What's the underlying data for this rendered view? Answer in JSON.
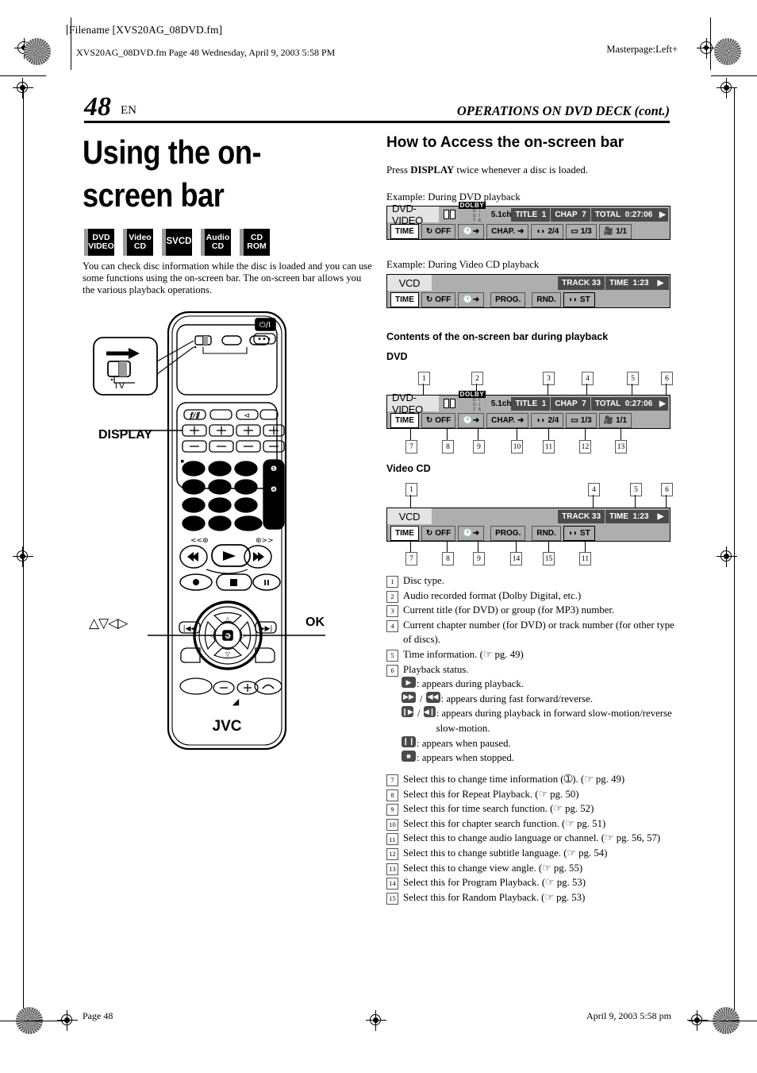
{
  "printer_header": {
    "filename_label": "Filename [XVS20AG_08DVD.fm]",
    "file_line": "XVS20AG_08DVD.fm  Page 48  Wednesday, April 9, 2003  5:58 PM",
    "masterpage": "Masterpage:Left+"
  },
  "page": {
    "number": "48",
    "locale": "EN",
    "running_head": "OPERATIONS ON DVD DECK (cont.)"
  },
  "left": {
    "title": "Using the on-screen bar",
    "disc_icons": [
      {
        "line1": "DVD",
        "line2": "VIDEO"
      },
      {
        "line1": "Video",
        "line2": "CD"
      },
      {
        "line1": "SVCD",
        "line2": ""
      },
      {
        "line1": "Audio",
        "line2": "CD"
      },
      {
        "line1": "CD",
        "line2": "ROM"
      }
    ],
    "lead_paragraph": "You can check disc information while the disc is loaded and you can use some functions using the on-screen bar. The on-screen bar allows you the various playback operations.",
    "callout_display": "DISPLAY",
    "callout_ok": "OK",
    "callout_arrows": "△▽◁▷",
    "remote_brand": "JVC",
    "tv_switch_label": "TV"
  },
  "right": {
    "heading_access": "How to Access the on-screen bar",
    "press_text_pre": "Press ",
    "press_text_bold": "DISPLAY",
    "press_text_post": " twice whenever a disc is loaded.",
    "example_dvd": "Example: During DVD playback",
    "example_vcd": "Example: During Video CD playback",
    "heading_contents": "Contents of the on-screen bar during playback",
    "label_dvd": "DVD",
    "label_videocd": "Video CD"
  },
  "osd_dvd": {
    "disc_type": "DVD-VIDEO",
    "audio_format": {
      "brand": "DOLBY",
      "sub": "D I G I T A L",
      "channels": "5.1ch"
    },
    "fields": [
      {
        "label": "TITLE",
        "value": "1"
      },
      {
        "label": "CHAP",
        "value": "7"
      },
      {
        "label": "TOTAL",
        "value": "0:27:06"
      }
    ],
    "status_icon": "play-icon",
    "buttons": [
      {
        "name": "time-button",
        "label": "TIME",
        "selected": true
      },
      {
        "name": "repeat-button",
        "label": "OFF",
        "icon": "repeat-icon"
      },
      {
        "name": "time-search-button",
        "label": "",
        "icon": "clock-arrow-icon"
      },
      {
        "name": "chapter-search-button",
        "label": "CHAP.",
        "icon": "arrow-icon"
      },
      {
        "name": "audio-button",
        "label": "2/4",
        "icon": "audio-icon"
      },
      {
        "name": "subtitle-button",
        "label": "1/3",
        "icon": "subtitle-icon"
      },
      {
        "name": "angle-button",
        "label": "1/1",
        "icon": "angle-icon"
      }
    ]
  },
  "osd_vcd": {
    "disc_type": "VCD",
    "fields": [
      {
        "label": "TRACK",
        "value": "33"
      },
      {
        "label": "TIME",
        "value": "1:23"
      }
    ],
    "status_icon": "play-icon",
    "buttons": [
      {
        "name": "time-button",
        "label": "TIME",
        "selected": true
      },
      {
        "name": "repeat-button",
        "label": "OFF",
        "icon": "repeat-icon"
      },
      {
        "name": "time-search-button",
        "label": "",
        "icon": "clock-arrow-icon"
      },
      {
        "name": "program-button",
        "label": "PROG."
      },
      {
        "name": "random-button",
        "label": "RND."
      },
      {
        "name": "audio-button",
        "label": "ST",
        "icon": "audio-icon"
      }
    ]
  },
  "callouts_dvd_top": [
    "1",
    "2",
    "3",
    "4",
    "5",
    "6"
  ],
  "callouts_dvd_bottom": [
    "7",
    "8",
    "9",
    "10",
    "11",
    "12",
    "13"
  ],
  "callouts_vcd_top": [
    "1",
    "4",
    "5",
    "6"
  ],
  "callouts_vcd_bottom": [
    "7",
    "8",
    "9",
    "14",
    "15",
    "11"
  ],
  "legend": [
    {
      "n": "1",
      "text": "Disc type."
    },
    {
      "n": "2",
      "text": "Audio recorded format (Dolby Digital, etc.)"
    },
    {
      "n": "3",
      "text": "Current title (for DVD) or group (for MP3) number."
    },
    {
      "n": "4",
      "text": "Current chapter number (for DVD) or track number (for other type of discs)."
    },
    {
      "n": "5",
      "text": "Time information. (☞ pg. 49)"
    },
    {
      "n": "6",
      "text": "Playback status."
    }
  ],
  "status_lines": [
    {
      "icons": [
        "play-icon"
      ],
      "text": ": appears during playback."
    },
    {
      "icons": [
        "fast-forward-icon",
        "rewind-icon"
      ],
      "text": ": appears during fast forward/reverse."
    },
    {
      "icons": [
        "slow-forward-icon",
        "slow-reverse-icon"
      ],
      "text": ": appears during playback in forward slow-motion/reverse slow-motion."
    },
    {
      "icons": [
        "pause-icon"
      ],
      "text": ": appears when paused."
    },
    {
      "icons": [
        "stop-icon"
      ],
      "text": ": appears when stopped."
    }
  ],
  "legend2": [
    {
      "n": "7",
      "text": "Select this to change time information (➀). (☞ pg. 49)"
    },
    {
      "n": "8",
      "text": "Select this for Repeat Playback. (☞ pg. 50)"
    },
    {
      "n": "9",
      "text": "Select this for time search function. (☞ pg. 52)"
    },
    {
      "n": "10",
      "text": "Select this for chapter search function. (☞ pg. 51)"
    },
    {
      "n": "11",
      "text": "Select this to change audio language or channel. (☞ pg. 56, 57)"
    },
    {
      "n": "12",
      "text": "Select this to change subtitle language. (☞ pg. 54)"
    },
    {
      "n": "13",
      "text": "Select this to change view angle. (☞ pg. 55)"
    },
    {
      "n": "14",
      "text": "Select this for Program Playback. (☞ pg. 53)"
    },
    {
      "n": "15",
      "text": "Select this for Random Playback. (☞ pg. 53)"
    }
  ],
  "footer": {
    "left": "Page 48",
    "right": "April 9, 2003 5:58 pm"
  }
}
